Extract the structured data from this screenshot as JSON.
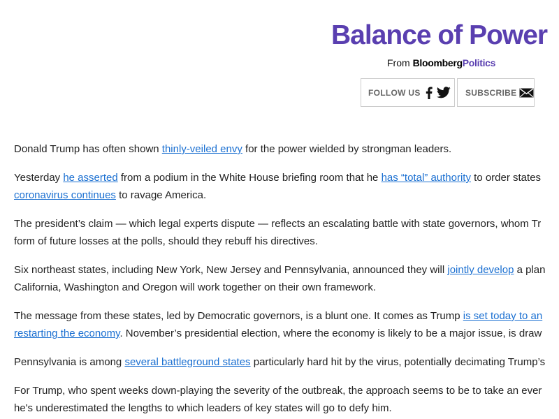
{
  "header": {
    "title": "Balance of Power",
    "byline_prefix": "From",
    "brand_part1": "Bloomberg",
    "brand_part2": "Politics"
  },
  "buttons": {
    "follow_label": "FOLLOW US",
    "subscribe_label": "SUBSCRIBE"
  },
  "icons": [
    "facebook-icon",
    "twitter-icon",
    "mail-icon"
  ],
  "colors": {
    "brand_purple": "#5a3fb0",
    "link_blue": "#1a6fd1",
    "body_text": "#222222"
  },
  "article": {
    "p1": {
      "t1": "Donald Trump has often shown ",
      "l1": "thinly-veiled envy",
      "t2": " for the power wielded by strongman leaders."
    },
    "p2": {
      "t1": "Yesterday ",
      "l1": "he asserted",
      "t2": " from a podium in the White House briefing room that he ",
      "l2": "has “total” authority",
      "t3": " to order states",
      "l3": "coronavirus continues",
      "t4": " to ravage America."
    },
    "p3": {
      "line1": "The president’s claim — which legal experts dispute — reflects an escalating battle with state governors, whom Tr",
      "line2": "form of future losses at the polls, should they rebuff his directives."
    },
    "p4": {
      "t1": "Six northeast states, including New York, New Jersey and Pennsylvania, announced they will ",
      "l1": "jointly develop",
      "t2": " a plan",
      "line2": "California, Washington and Oregon will work together on their own framework."
    },
    "p5": {
      "t1": "The message from these states, led by Democratic governors, is a blunt one. It comes as Trump ",
      "l1": "is set today to an",
      "l2": "restarting the economy",
      "t2": ". November’s presidential election, where the economy is likely to be a major issue, is draw"
    },
    "p6": {
      "t1": "Pennsylvania is among ",
      "l1": "several battleground states",
      "t2": " particularly hard hit by the virus, potentially decimating Trump’s"
    },
    "p7": {
      "line1": "For Trump, who spent weeks down-playing the severity of the outbreak, the approach seems to be to take an ever",
      "line2": "he's underestimated the lengths to which leaders of key states will go to defy him."
    }
  }
}
